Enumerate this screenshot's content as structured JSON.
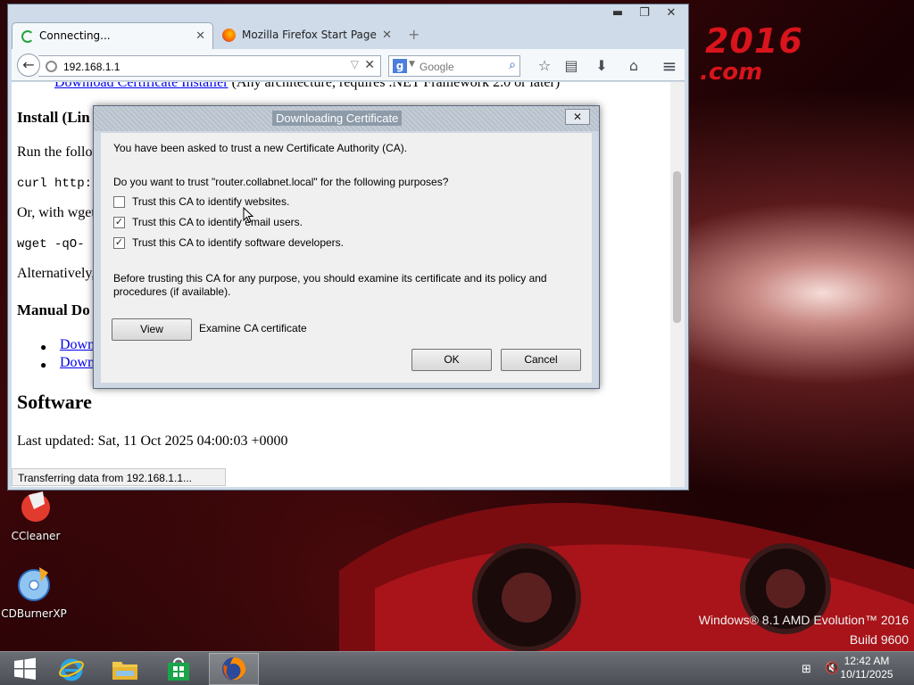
{
  "desktop": {
    "wallpaper_title": "2016",
    "wallpaper_sub": ".com",
    "icons": [
      {
        "label": "CCleaner",
        "icon": "ccleaner-icon"
      },
      {
        "label": "CDBurnerXP",
        "icon": "cd-burner-icon"
      }
    ],
    "watermark": {
      "line1": "Windows® 8.1 AMD Evolution™ 2016",
      "line2": "Build 9600"
    }
  },
  "browser": {
    "window_controls": {
      "minimize": "▬",
      "restore": "❐",
      "close": "✕"
    },
    "tabs": [
      {
        "label": "Connecting...",
        "close": "✕",
        "active": true
      },
      {
        "label": "Mozilla Firefox Start Page",
        "close": "✕",
        "active": false
      }
    ],
    "new_tab": "+",
    "url": "192.168.1.1",
    "search_placeholder": "Google",
    "toolbar_icons": [
      "star-icon",
      "reading-list-icon",
      "download-icon",
      "home-icon",
      "menu-icon"
    ],
    "status": "Transferring data from 192.168.1.1...",
    "page": {
      "top_link": "Download Certificate Installer",
      "top_rest": "(Any architecture, requires .NET Framework 2.0 or later)",
      "h3_install": "Install (Lin",
      "run_text": "Run the follow",
      "curl_text": "curl http:/",
      "or_text": "Or, with wget:",
      "wget_text": "wget -qO- h",
      "alt_text": "Alternatively, y",
      "h3_manual": "Manual Do",
      "links": [
        "Download",
        "Download"
      ],
      "h2_software": "Software",
      "updated": "Last updated: Sat, 11 Oct 2025 04:00:03 +0000"
    }
  },
  "dialog": {
    "title": "Downloading Certificate",
    "close": "✕",
    "intro": "You have been asked to trust a new Certificate Authority (CA).",
    "question": "Do you want to trust \"router.collabnet.local\" for the following purposes?",
    "options": [
      {
        "label": "Trust this CA to identify websites.",
        "checked": false
      },
      {
        "label": "Trust this CA to identify email users.",
        "checked": true
      },
      {
        "label": "Trust this CA to identify software developers.",
        "checked": true
      }
    ],
    "advice": "Before trusting this CA for any purpose, you should examine its certificate and its policy and procedures (if available).",
    "view_button": "View",
    "view_desc": "Examine CA certificate",
    "ok_button": "OK",
    "cancel_button": "Cancel"
  },
  "taskbar": {
    "apps": [
      "windows-start-icon",
      "internet-explorer-icon",
      "file-explorer-icon",
      "store-icon",
      "firefox-icon"
    ],
    "time": "12:42 AM",
    "date": "10/11/2025"
  },
  "colors": {
    "accent_red": "#d8141c",
    "link": "#0000ee",
    "taskbar": "#55595f"
  }
}
